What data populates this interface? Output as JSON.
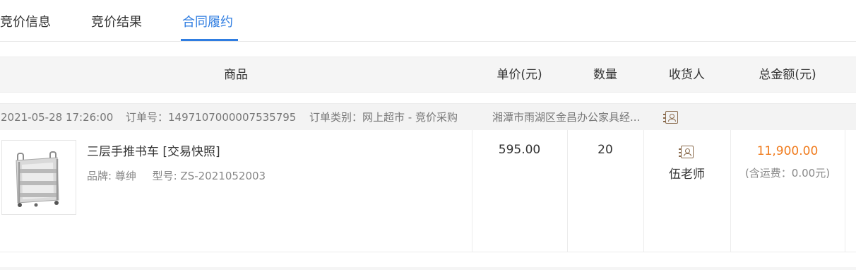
{
  "tabs": [
    {
      "label": "竞价信息"
    },
    {
      "label": "竞价结果"
    },
    {
      "label": "合同履约"
    }
  ],
  "active_tab_index": 2,
  "accent_color": "#2f7de1",
  "amount_color": "#f07b1d",
  "table": {
    "headers": {
      "product": "商品",
      "unit_price": "单价(元)",
      "quantity": "数量",
      "receiver": "收货人",
      "total": "总金额(元)"
    }
  },
  "order": {
    "datetime": "2021-05-28 17:26:00",
    "order_no": "订单号：1497107000007535795",
    "order_type": "订单类别：网上超市 - 竞价采购",
    "supplier": "湘潭市雨湖区金昌办公家具经...",
    "supplier_icon": "contact-card-icon"
  },
  "item": {
    "name": "三层手推书车 [交易快照]",
    "brand": "品牌: 尊绅",
    "model": "型号: ZS-2021052003",
    "image_alt": "three-tier book cart",
    "unit_price": "595.00",
    "quantity": "20",
    "receiver_icon": "contact-card-icon",
    "receiver": "伍老师",
    "total": "11,900.00",
    "freight": "(含运费：0.00元)"
  }
}
